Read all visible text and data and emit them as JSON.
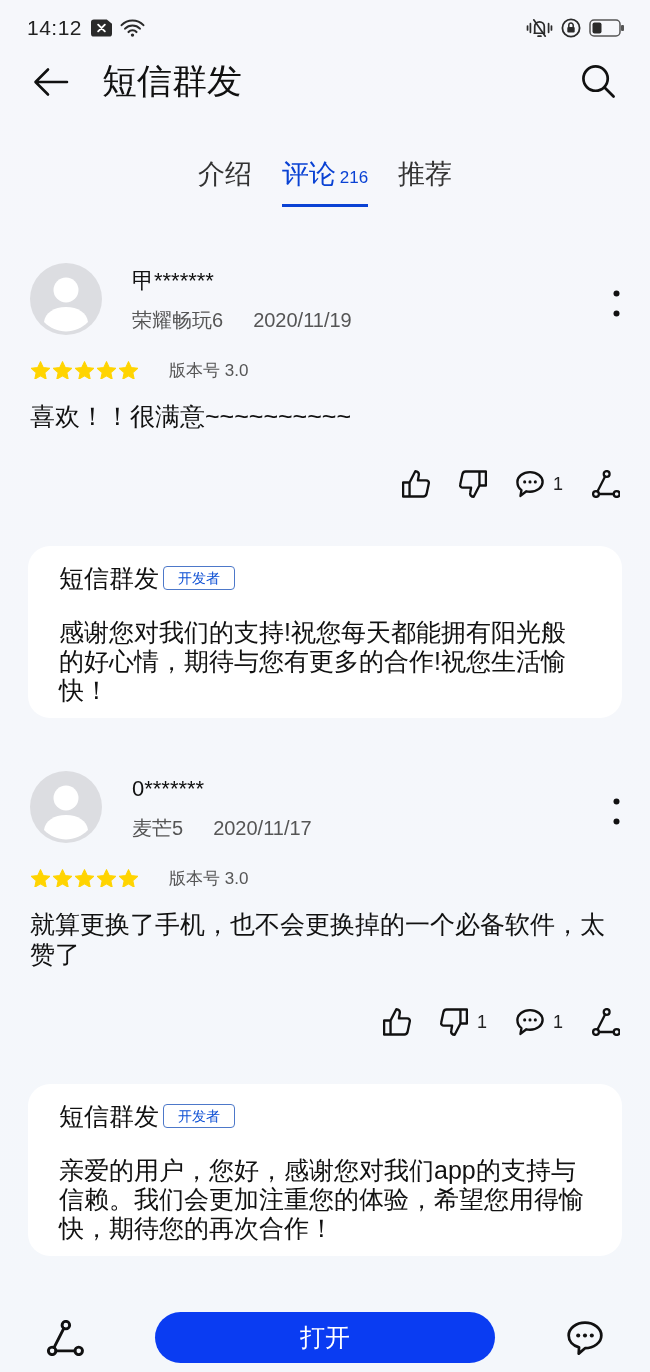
{
  "status_bar": {
    "time": "14:12"
  },
  "header": {
    "title": "短信群发"
  },
  "tabs": [
    {
      "label": "介绍",
      "selected": false
    },
    {
      "label": "评论",
      "count": "216",
      "selected": true
    },
    {
      "label": "推荐",
      "selected": false
    }
  ],
  "reviews": [
    {
      "user": "甲*******",
      "device": "荣耀畅玩6",
      "date": "2020/11/19",
      "stars": 5,
      "version": "版本号 3.0",
      "content": "喜欢！！很满意~~~~~~~~~~",
      "actions": [
        {
          "kind": "like"
        },
        {
          "kind": "dislike"
        },
        {
          "kind": "comment",
          "count": "1"
        },
        {
          "kind": "share"
        }
      ],
      "reply": {
        "author": "短信群发",
        "badge": "开发者",
        "text": "感谢您对我们的支持!祝您每天都能拥有阳光般的好心情，期待与您有更多的合作!祝您生活愉快！"
      }
    },
    {
      "user": "0*******",
      "device": "麦芒5",
      "date": "2020/11/17",
      "stars": 5,
      "version": "版本号 3.0",
      "content": "就算更换了手机，也不会更换掉的一个必备软件，太赞了",
      "actions": [
        {
          "kind": "like"
        },
        {
          "kind": "dislike",
          "count": "1"
        },
        {
          "kind": "comment",
          "count": "1"
        },
        {
          "kind": "share"
        }
      ],
      "reply": {
        "author": "短信群发",
        "badge": "开发者",
        "text": "亲爱的用户，您好，感谢您对我们app的支持与信赖。我们会更加注重您的体验，希望您用得愉快，期待您的再次合作！"
      }
    }
  ],
  "bottom_bar": {
    "button": "打开"
  }
}
